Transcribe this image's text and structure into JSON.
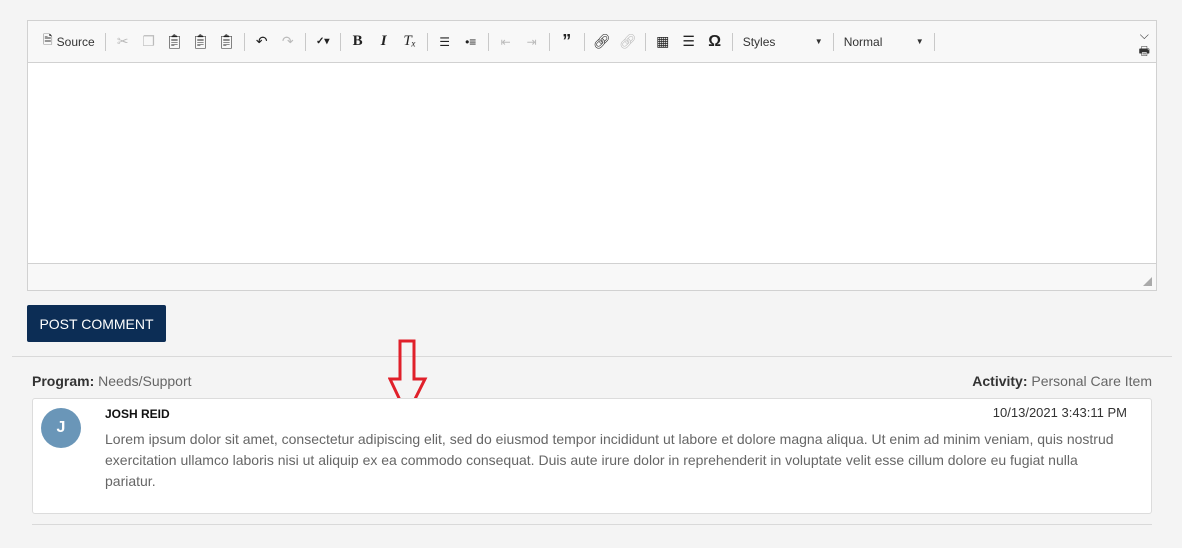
{
  "toolbar": {
    "source_label": "Source",
    "styles_label": "Styles",
    "format_label": "Normal"
  },
  "post_button_label": "POST COMMENT",
  "meta": {
    "program_label": "Program:",
    "program_value": "Needs/Support",
    "activity_label": "Activity:",
    "activity_value": "Personal Care Item"
  },
  "comment": {
    "avatar_initial": "J",
    "author": "JOSH REID",
    "timestamp": "10/13/2021 3:43:11 PM",
    "text": "Lorem ipsum dolor sit amet, consectetur adipiscing elit, sed do eiusmod tempor incididunt ut labore et dolore magna aliqua. Ut enim ad minim veniam, quis nostrud exercitation ullamco laboris nisi ut aliquip ex ea commodo consequat. Duis aute irure dolor in reprehenderit in voluptate velit esse cillum dolore eu fugiat nulla pariatur."
  },
  "colors": {
    "post_button": "#0c2d55",
    "avatar": "#6a96b8",
    "annotation_arrow": "#e0202a"
  }
}
